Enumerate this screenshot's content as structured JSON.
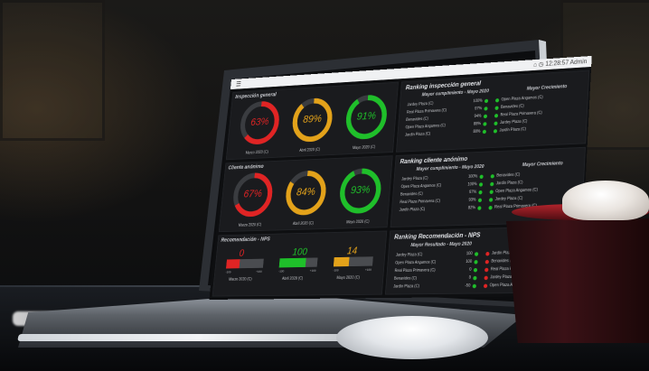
{
  "topbar": {
    "menu_icon": "hamburger-icon",
    "time": "12:28:57",
    "user": "Admin"
  },
  "panels": [
    {
      "title": "Inspección general",
      "gauges": [
        {
          "value": "63%",
          "label": "Marzo 2020 (C)",
          "color": "#e02424",
          "fraction": 0.63
        },
        {
          "value": "89%",
          "label": "Abril 2020 (C)",
          "color": "#e3a21a",
          "fraction": 0.89
        },
        {
          "value": "91%",
          "label": "Mayo 2020 (C)",
          "color": "#1fbf2a",
          "fraction": 0.91
        }
      ]
    },
    {
      "title": "Cliente anónimo",
      "gauges": [
        {
          "value": "67%",
          "label": "Marzo 2020 (C)",
          "color": "#e02424",
          "fraction": 0.67
        },
        {
          "value": "84%",
          "label": "Abril 2020 (C)",
          "color": "#e3a21a",
          "fraction": 0.84
        },
        {
          "value": "93%",
          "label": "Mayo 2020 (C)",
          "color": "#1fbf2a",
          "fraction": 0.93
        }
      ]
    }
  ],
  "nps": {
    "title": "Recomendación - NPS",
    "bars": [
      {
        "value": "0",
        "label": "Marzo 2020 (C)",
        "color": "#e02424",
        "fraction": 0.5,
        "min": "-100",
        "max": "+100"
      },
      {
        "value": "100",
        "label": "Abril 2020 (C)",
        "color": "#1fbf2a",
        "fraction": 1.0,
        "min": "-100",
        "max": "+100"
      },
      {
        "value": "14",
        "label": "Mayo 2020 (C)",
        "color": "#e3a21a",
        "fraction": 0.57,
        "min": "-100",
        "max": "+100"
      }
    ]
  },
  "rankings": [
    {
      "title": "Ranking inspección general",
      "sub_left": "Mayor cumplimiento - Mayo 2020",
      "sub_right": "Mayor Crecimiento",
      "left": [
        {
          "name": "Jardey Plaza (C)",
          "pct": "100%"
        },
        {
          "name": "Real Plaza Primavera (C)",
          "pct": "97%"
        },
        {
          "name": "Benavides (C)",
          "pct": "94%"
        },
        {
          "name": "Open Plaza Angamos (C)",
          "pct": "88%"
        },
        {
          "name": "Jardín Plaza (C)",
          "pct": "80%"
        }
      ],
      "right": [
        {
          "name": "Open Plaza Angamos (C)"
        },
        {
          "name": "Benavides (C)"
        },
        {
          "name": "Real Plaza Primavera (C)"
        },
        {
          "name": "Jardey Plaza (C)"
        },
        {
          "name": "Jardín Plaza (C)"
        }
      ]
    },
    {
      "title": "Ranking cliente anónimo",
      "sub_left": "Mayor cumplimiento - Mayo 2020",
      "sub_right": "Mayor Crecimiento",
      "left": [
        {
          "name": "Jardey Plaza (C)",
          "pct": "100%"
        },
        {
          "name": "Open Plaza Angamos (C)",
          "pct": "100%"
        },
        {
          "name": "Benavides (C)",
          "pct": "97%"
        },
        {
          "name": "Real Plaza Primavera (C)",
          "pct": "93%"
        },
        {
          "name": "Jardín Plaza (C)",
          "pct": "82%"
        }
      ],
      "right": [
        {
          "name": "Benavides (C)"
        },
        {
          "name": "Jardín Plaza (C)"
        },
        {
          "name": "Open Plaza Angamos (C)"
        },
        {
          "name": "Jardey Plaza (C)"
        },
        {
          "name": "Real Plaza Primavera (C)"
        }
      ]
    },
    {
      "title": "Ranking Recomendación - NPS",
      "sub_left": "Mayor Resultado - Mayo 2020",
      "sub_right": "Peor R",
      "left": [
        {
          "name": "Jardey Plaza (C)",
          "pct": "100"
        },
        {
          "name": "Open Plaza Angamos (C)",
          "pct": "100"
        },
        {
          "name": "Real Plaza Primavera (C)",
          "pct": "0"
        },
        {
          "name": "Benavides (C)",
          "pct": "0"
        },
        {
          "name": "Jardín Plaza (C)",
          "pct": "-50"
        }
      ],
      "right": [
        {
          "name": "Jardín Plaza (C)"
        },
        {
          "name": "Benavides (C)"
        },
        {
          "name": "Real Plaza Primavera"
        },
        {
          "name": "Jardey Plaza (C)"
        },
        {
          "name": "Open Plaza Angamos"
        }
      ]
    }
  ]
}
